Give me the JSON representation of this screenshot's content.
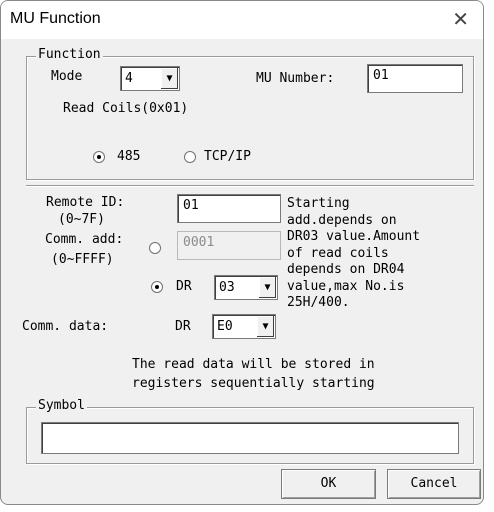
{
  "window": {
    "title": "MU Function",
    "close_icon": "close-icon"
  },
  "function_group": {
    "legend": "Function",
    "mode_label": "Mode",
    "mode_value": "4",
    "mu_number_label": "MU Number:",
    "mu_number_value": "01",
    "description": "Read Coils(0x01)",
    "port_options": [
      "485",
      "TCP/IP"
    ],
    "port_selected": "485"
  },
  "remote": {
    "remote_id_label": "Remote ID:",
    "remote_id_range": "(0~7F)",
    "remote_id_value": "01",
    "comm_add_label": "Comm. add:",
    "comm_add_range": "(0~FFFF)",
    "comm_add_value": "0001",
    "dr_label": "DR",
    "dr_value": "03",
    "comm_data_label": "Comm. data:",
    "comm_data_dr_label": "DR",
    "comm_data_value": "E0",
    "note_lines": [
      "Starting",
      "add.depends on",
      "DR03 value.Amount",
      "of read coils",
      "depends on DR04",
      "value,max No.is",
      "25H/400."
    ],
    "stored_line1": "The read data will be stored in",
    "stored_line2": "registers sequentially starting"
  },
  "symbol_group": {
    "legend": "Symbol",
    "value": ""
  },
  "buttons": {
    "ok": "OK",
    "cancel": "Cancel"
  }
}
